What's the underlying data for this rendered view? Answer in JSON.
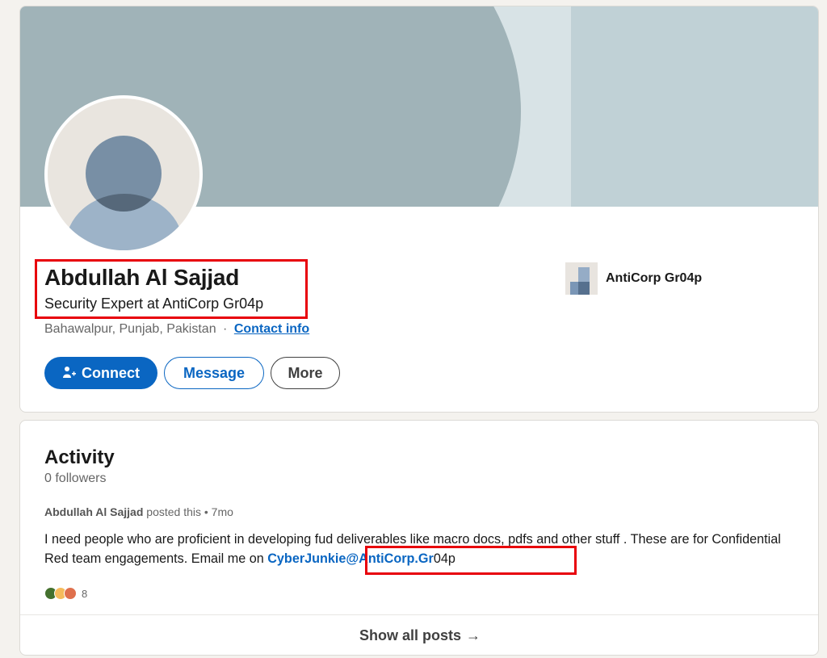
{
  "profile": {
    "name": "Abdullah Al Sajjad",
    "headline": "Security Expert at AntiCorp Gr04p",
    "location": "Bahawalpur, Punjab, Pakistan",
    "location_separator": "·",
    "contact_info_label": "Contact info",
    "company_name": "AntiCorp Gr04p"
  },
  "actions": {
    "connect_label": "Connect",
    "message_label": "Message",
    "more_label": "More"
  },
  "activity": {
    "title": "Activity",
    "followers": "0 followers",
    "post": {
      "author": "Abdullah Al Sajjad",
      "meta_suffix": "posted this • 7mo",
      "text": "I need people who are proficient in developing fud deliverables like macro docs, pdfs and other stuff . These are for Confidential Red team engagements. Email me on ",
      "email_link": "CyberJunkie@AntiCorp.Gr",
      "email_tail": "04p",
      "reaction_count": "8"
    },
    "show_all_label": "Show all posts",
    "show_all_arrow": "→"
  },
  "colors": {
    "brand_blue": "#0a66c2",
    "highlight_red": "#e8000b",
    "page_bg": "#f4f2ee"
  },
  "icons": {
    "connect": "add-person-icon",
    "reactions": [
      "celebrate-icon",
      "insightful-icon",
      "love-icon"
    ],
    "show_all": "arrow-right-icon"
  }
}
